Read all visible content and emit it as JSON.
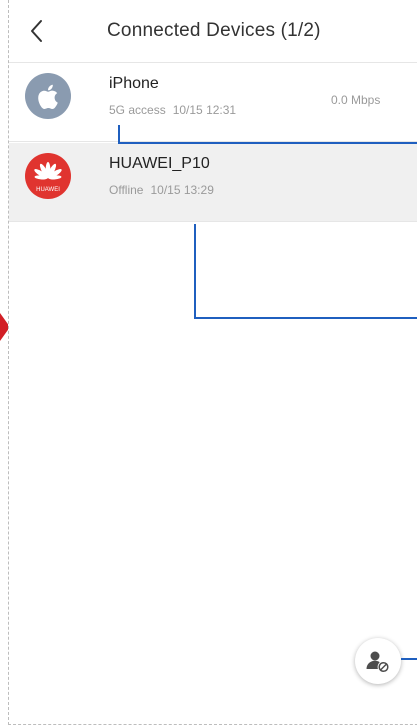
{
  "header": {
    "back_icon": "chevron-left-icon",
    "title": "Connected Devices (1/2)"
  },
  "devices": [
    {
      "name": "iPhone",
      "icon": "apple-logo-icon",
      "status": "5G access",
      "time": "10/15 12:31",
      "speed": "0.0 Mbps",
      "avatar_color": "#8a9bb0"
    },
    {
      "name": "HUAWEI_P10",
      "icon": "huawei-logo-icon",
      "logo_text": "HUAWEI",
      "status": "Offline",
      "time": "10/15 13:29",
      "avatar_color": "#e0342f"
    }
  ],
  "fab": {
    "icon": "user-block-icon"
  },
  "colors": {
    "callout": "#1f5fbf",
    "marker": "#d21f26",
    "selected_row": "#f0f0f0"
  }
}
